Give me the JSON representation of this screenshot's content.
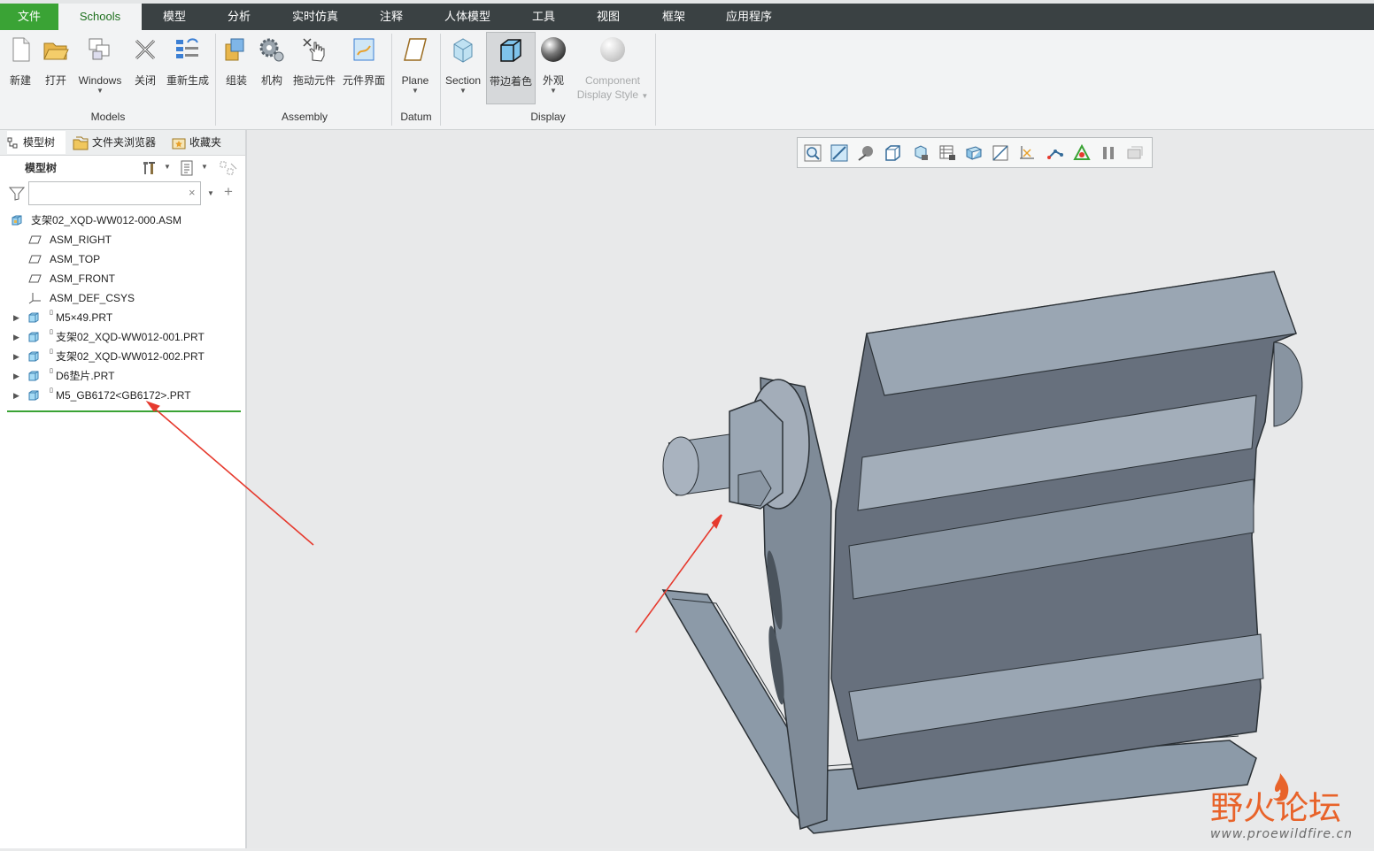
{
  "menu": {
    "file": "文件",
    "schools": "Schools",
    "model": "模型",
    "analysis": "分析",
    "simulate": "实时仿真",
    "annotate": "注释",
    "manikin": "人体模型",
    "tools": "工具",
    "view": "视图",
    "framework": "框架",
    "apps": "应用程序"
  },
  "ribbon": {
    "models": {
      "new": "新建",
      "open": "打开",
      "windows": "Windows",
      "close": "关闭",
      "regenerate": "重新生成",
      "group": "Models"
    },
    "assembly": {
      "assemble": "组装",
      "mechanism": "机构",
      "drag": "拖动元件",
      "interface": "元件界面",
      "group": "Assembly"
    },
    "datum": {
      "plane": "Plane",
      "group": "Datum"
    },
    "display": {
      "section": "Section",
      "shaded_edges": "带边着色",
      "appearance": "外观",
      "component_line1": "Component",
      "component_line2": "Display Style",
      "group": "Display"
    }
  },
  "panel": {
    "tabs": {
      "model_tree": "模型树",
      "folder_browser": "文件夹浏览器",
      "favorites": "收藏夹"
    },
    "tree_header": "模型树",
    "search": {
      "placeholder": ""
    },
    "items": [
      {
        "label": "支架02_XQD-WW012-000.ASM",
        "icon": "assembly-icon"
      },
      {
        "label": "ASM_RIGHT",
        "icon": "datum-plane-icon"
      },
      {
        "label": "ASM_TOP",
        "icon": "datum-plane-icon"
      },
      {
        "label": "ASM_FRONT",
        "icon": "datum-plane-icon"
      },
      {
        "label": "ASM_DEF_CSYS",
        "icon": "csys-icon"
      },
      {
        "label": "M5×49.PRT",
        "icon": "part-icon"
      },
      {
        "label": "支架02_XQD-WW012-001.PRT",
        "icon": "part-icon"
      },
      {
        "label": "支架02_XQD-WW012-002.PRT",
        "icon": "part-icon"
      },
      {
        "label": "D6垫片.PRT",
        "icon": "part-icon"
      },
      {
        "label": "M5_GB6172<GB6172>.PRT",
        "icon": "part-icon"
      }
    ]
  },
  "watermark": {
    "title": "野火论坛",
    "url": "www.proewildfire.cn"
  },
  "colors": {
    "accent_green": "#3aa335",
    "menubar": "#3a4143",
    "annotation_red": "#e63a2e"
  }
}
